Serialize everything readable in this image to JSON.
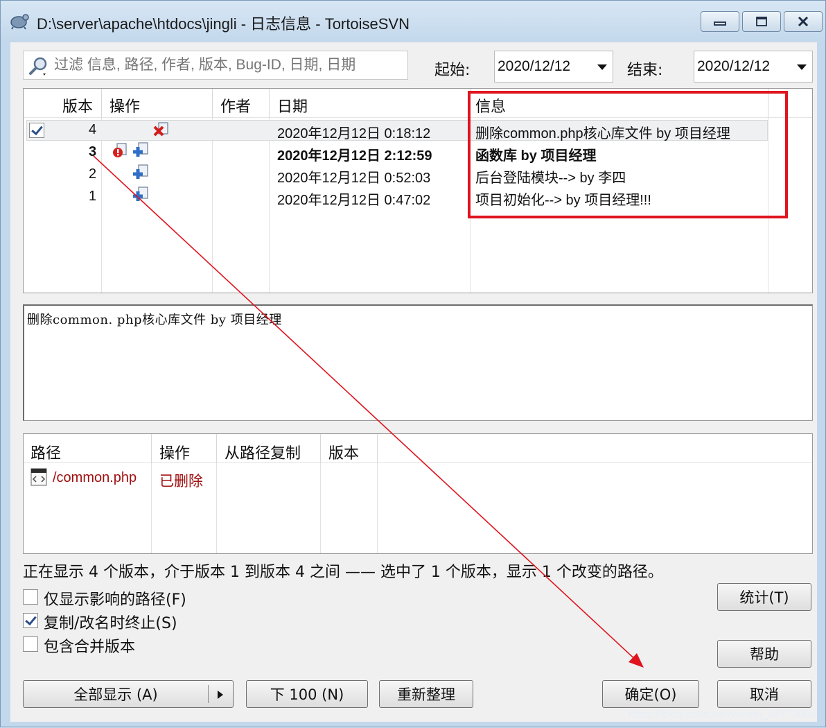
{
  "window": {
    "title": "D:\\server\\apache\\htdocs\\jingli - 日志信息 - TortoiseSVN"
  },
  "filter": {
    "placeholder": "过滤 信息, 路径, 作者, 版本, Bug-ID, 日期, 日期"
  },
  "date_range": {
    "start_label": "起始:",
    "start_value": "2020/12/12",
    "end_label": "结束:",
    "end_value": "2020/12/12"
  },
  "revisions": {
    "columns": [
      "版本",
      "操作",
      "作者",
      "日期",
      "信息"
    ],
    "rows": [
      {
        "rev": "4",
        "date": "2020年12月12日 0:18:12",
        "msg": "删除common.php核心库文件  by  项目经理",
        "checked": true,
        "bold": false
      },
      {
        "rev": "3",
        "date": "2020年12月12日 2:12:59",
        "msg": "函数库 by 项目经理",
        "checked": false,
        "bold": true
      },
      {
        "rev": "2",
        "date": "2020年12月12日 0:52:03",
        "msg": "后台登陆模块--> by 李四",
        "checked": false,
        "bold": false
      },
      {
        "rev": "1",
        "date": "2020年12月12日 0:47:02",
        "msg": "项目初始化--> by 项目经理!!!",
        "checked": false,
        "bold": false
      }
    ]
  },
  "message_detail": "删除common. php核心库文件    by    项目经理",
  "paths": {
    "columns": [
      "路径",
      "操作",
      "从路径复制",
      "版本"
    ],
    "rows": [
      {
        "path": "/common.php",
        "action": "已删除"
      }
    ]
  },
  "status_text": "正在显示 4 个版本，介于版本 1 到版本 4 之间 —— 选中了 1 个版本，显示 1 个改变的路径。",
  "options": [
    {
      "label": "仅显示影响的路径(F)",
      "checked": false
    },
    {
      "label": "复制/改名时终止(S)",
      "checked": true
    },
    {
      "label": "包含合并版本",
      "checked": false
    }
  ],
  "buttons": {
    "stats": "统计(T)",
    "help": "帮助",
    "show_all": "全部显示 (A)",
    "next100": "下 100 (N)",
    "refresh": "重新整理",
    "ok": "确定(O)",
    "cancel": "取消"
  },
  "watermark": "https://blog.csdn.net/weixin_44773006",
  "colors": {
    "annotation_red": "#e0141e",
    "deleted_path": "#a01010"
  },
  "icons": {
    "title": "tortoisesvn-icon",
    "filter": "magnifier-icon",
    "delete_action": "delete-x-icon",
    "add_action": "add-plus-icon",
    "conflict": "warning-icon",
    "file": "php-file-icon"
  }
}
